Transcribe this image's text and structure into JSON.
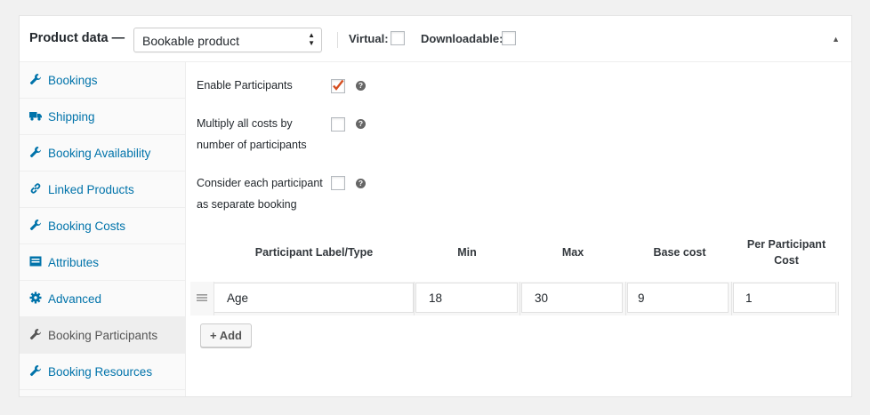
{
  "header": {
    "title": "Product data —",
    "product_type": "Bookable product",
    "virtual_label": "Virtual:",
    "downloadable_label": "Downloadable:",
    "toggle_icon": "triangle-up-icon"
  },
  "sidebar": {
    "items": [
      {
        "label": "Bookings",
        "icon": "wrench-icon",
        "active": false
      },
      {
        "label": "Shipping",
        "icon": "truck-icon",
        "active": false
      },
      {
        "label": "Booking Availability",
        "icon": "wrench-icon",
        "active": false
      },
      {
        "label": "Linked Products",
        "icon": "link-icon",
        "active": false
      },
      {
        "label": "Booking Costs",
        "icon": "wrench-icon",
        "active": false
      },
      {
        "label": "Attributes",
        "icon": "list-icon",
        "active": false
      },
      {
        "label": "Advanced",
        "icon": "gear-icon",
        "active": false
      },
      {
        "label": "Booking Participants",
        "icon": "wrench-icon",
        "active": true
      },
      {
        "label": "Booking Resources",
        "icon": "wrench-icon",
        "active": false
      }
    ]
  },
  "main": {
    "enable_participants": {
      "label": "Enable Participants",
      "checked": true
    },
    "multiply_costs": {
      "label_line1": "Multiply all costs by",
      "label_line2": "number of participants",
      "checked": false
    },
    "consider_each": {
      "label_line1": "Consider each participant",
      "label_line2": "as separate booking",
      "checked": false
    },
    "help_glyph": "?",
    "table": {
      "headers": {
        "label_type": "Participant Label/Type",
        "min": "Min",
        "max": "Max",
        "base_cost": "Base cost",
        "per_participant_line1": "Per Participant",
        "per_participant_line2": "Cost"
      },
      "rows": [
        {
          "label": "Age",
          "min": "18",
          "max": "30",
          "base_cost": "9",
          "per_participant_cost": "1"
        }
      ]
    },
    "add_button": "+ Add"
  },
  "colors": {
    "link": "#0073aa",
    "checkmark": "#d54e21",
    "active_item_bg": "#eeeeee"
  }
}
